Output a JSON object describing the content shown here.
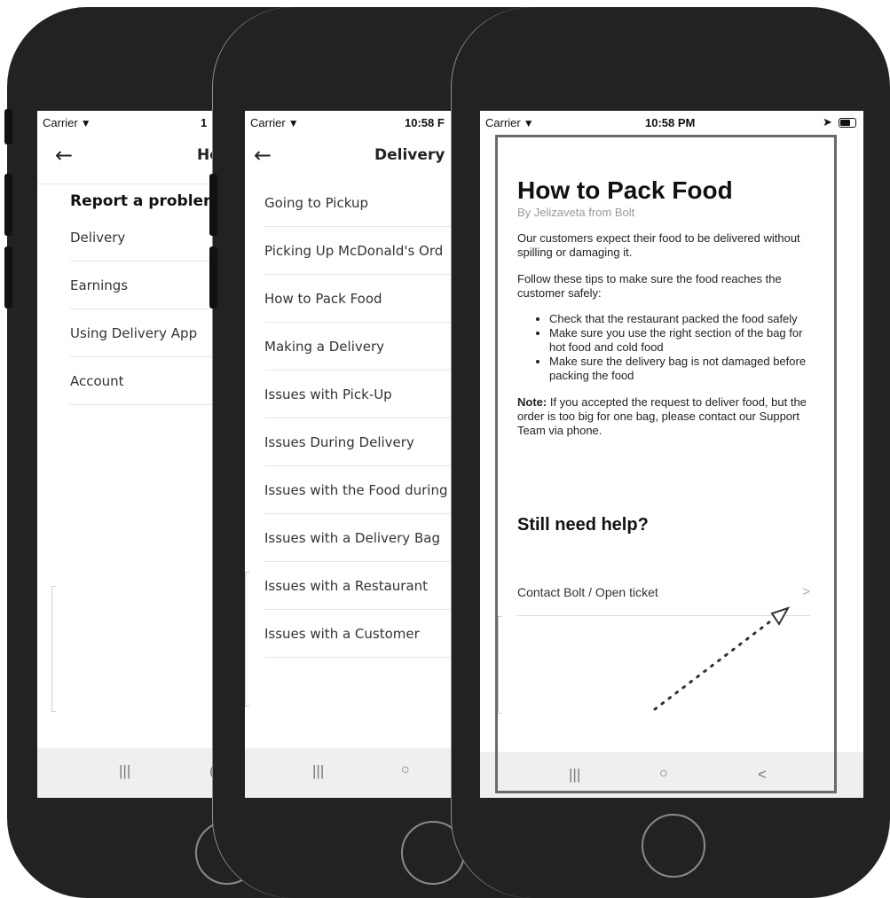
{
  "status": {
    "carrier": "Carrier",
    "time": "10:58 PM"
  },
  "screen1": {
    "nav_title": "He",
    "section_title": "Report a problem",
    "items": [
      "Delivery",
      "Earnings",
      "Using Delivery App",
      "Account"
    ],
    "time_partial": "1",
    "nav_buttons": [
      "|||",
      "("
    ]
  },
  "screen2": {
    "time": "10:58 F",
    "nav_title": "Delivery",
    "items": [
      "Going to Pickup",
      "Picking Up McDonald's Ord",
      "How to Pack Food",
      "Making a Delivery",
      "Issues with Pick-Up",
      "Issues During Delivery",
      "Issues with the Food during D",
      "Issues with a Delivery Bag",
      "Issues with a Restaurant",
      "Issues with a Customer"
    ],
    "nav_buttons": [
      "|||",
      "○"
    ]
  },
  "screen3": {
    "title": "How to Pack Food",
    "byline": "By Jelizaveta from Bolt",
    "para1": "Our customers expect their food to be delivered without spilling or damaging it.",
    "para2": "Follow these tips to make sure the food reaches the customer safely:",
    "tips": [
      "Check that the restaurant packed the food safely",
      "Make sure you use the right section of the bag for hot food and cold food",
      "Make sure the delivery bag is not damaged before packing the food"
    ],
    "note_label": "Note:",
    "note_text": " If you accepted the request to deliver food, but the order is too big for one bag, please contact our Support Team via phone.",
    "help_heading": "Still need help?",
    "contact_label": "Contact Bolt / Open ticket",
    "contact_chevron": ">",
    "nav_buttons": [
      "|||",
      "○",
      "<"
    ]
  },
  "colors": {
    "phone_body": "#222222",
    "screen_bg": "#ffffff",
    "navbar_bg": "#efefef",
    "highlight_border": "#6a6a6a"
  },
  "icons": [
    "wifi-icon",
    "back-arrow-icon",
    "location-arrow-icon",
    "battery-icon",
    "chevron-right-icon",
    "home-button-icon"
  ]
}
